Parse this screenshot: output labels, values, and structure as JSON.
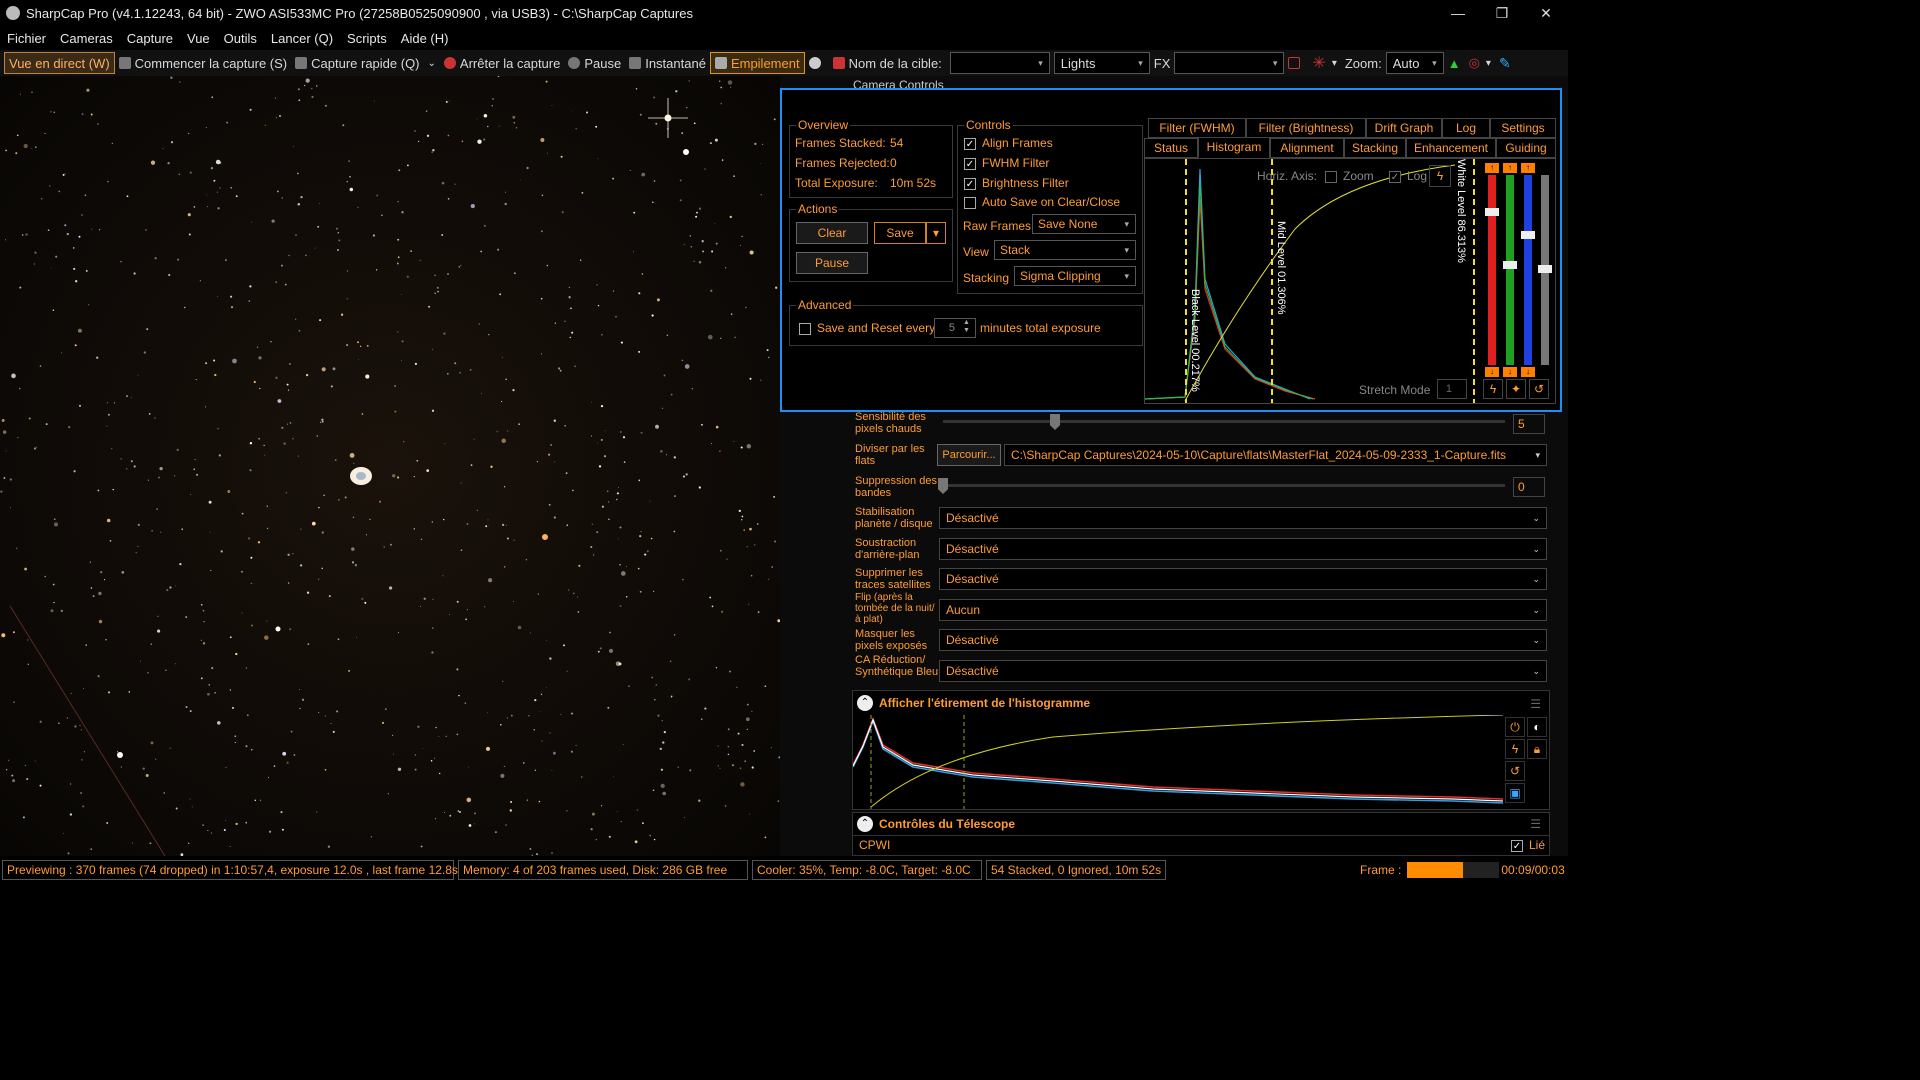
{
  "window": {
    "title": "SharpCap Pro (v4.1.12243, 64 bit) - ZWO ASI533MC Pro (27258B0525090900 , via USB3) - C:\\SharpCap Captures",
    "min": "—",
    "max": "❐",
    "close": "✕"
  },
  "menu": [
    "Fichier",
    "Cameras",
    "Capture",
    "Vue",
    "Outils",
    "Lancer (Q)",
    "Scripts",
    "Aide (H)"
  ],
  "toolbar": {
    "live": "Vue en direct (W)",
    "start_capture": "Commencer la capture (S)",
    "quick_capture": "Capture rapide (Q)",
    "stop_capture": "Arrêter la capture",
    "pause": "Pause",
    "snapshot": "Instantané",
    "stacking": "Empilement",
    "target_label": "Nom de la cible:",
    "target_value": "",
    "frame_type": "Lights",
    "fx_label": "FX",
    "fx_value": "",
    "zoom_label": "Zoom:",
    "zoom_value": "Auto"
  },
  "camera_controls_title": "Camera Controls",
  "stack": {
    "overview_legend": "Overview",
    "frames_stacked_label": "Frames Stacked:",
    "frames_stacked": "54",
    "frames_rejected_label": "Frames Rejected:",
    "frames_rejected": "0",
    "total_exposure_label": "Total Exposure:",
    "total_exposure": "10m 52s",
    "actions_legend": "Actions",
    "clear": "Clear",
    "save": "Save",
    "pause": "Pause",
    "advanced_legend": "Advanced",
    "save_reset_label": "Save and Reset every",
    "save_reset_value": "5",
    "save_reset_suffix": "minutes total exposure",
    "controls_legend": "Controls",
    "align_frames": "Align Frames",
    "fwhm_filter": "FWHM Filter",
    "brightness_filter": "Brightness Filter",
    "auto_save": "Auto Save on Clear/Close",
    "raw_frames_label": "Raw Frames",
    "raw_frames_value": "Save None",
    "view_label": "View",
    "view_value": "Stack",
    "stacking_label": "Stacking",
    "stacking_value": "Sigma Clipping",
    "tabs_top": [
      "Filter (FWHM)",
      "Filter (Brightness)",
      "Drift Graph",
      "Log",
      "Settings"
    ],
    "tabs_bottom": [
      "Status",
      "Histogram",
      "Alignment",
      "Stacking",
      "Enhancement",
      "Guiding"
    ],
    "horiz_axis": "Horiz. Axis:",
    "zoom": "Zoom",
    "log": "Log",
    "black_level": "Black Level  00.217%",
    "mid_level": "Mid Level  01.306%",
    "white_level": "White Level  86.313%",
    "stretch_mode": "Stretch Mode",
    "stretch_value": "1"
  },
  "props": {
    "hot_pixels_label": "Sensibilité des pixels chauds",
    "hot_pixels_value": "5",
    "flats_label": "Diviser par les flats",
    "browse": "Parcourir...",
    "flats_path": "C:\\SharpCap Captures\\2024-05-10\\Capture\\flats\\MasterFlat_2024-05-09-2333_1-Capture.fits",
    "banding_label": "Suppression des bandes",
    "banding_value": "0",
    "stab_label": "Stabilisation planète / disque",
    "stab_value": "Désactivé",
    "bgsub_label": "Soustraction d'arrière-plan",
    "bgsub_value": "Désactivé",
    "sat_label": "Supprimer les traces satellites",
    "sat_value": "Désactivé",
    "flip_label": "Flip (après la tombée de la nuit/à plat)",
    "flip_value": "Aucun",
    "mask_label": "Masquer les pixels exposés",
    "mask_value": "Désactivé",
    "ca_label": "CA Réduction/ Synthétique Bleu",
    "ca_value": "Désactivé"
  },
  "histo_panel": {
    "title": "Afficher l'étirement de l'histogramme"
  },
  "telescope": {
    "title": "Contrôles du Télescope",
    "mount": "CPWI",
    "linked": "Lié"
  },
  "statusbar": {
    "preview": "Previewing : 370 frames (74 dropped) in 1:10:57,4, exposure 12.0s , last frame 12.8s",
    "memory": "Memory: 4 of 203 frames used, Disk: 286 GB free",
    "cooler": "Cooler: 35%, Temp: -8.0C, Target: -8.0C",
    "stacked": "54 Stacked, 0 Ignored, 10m 52s",
    "frame_label": "Frame :",
    "frame_progress": 0.6,
    "frame_time": "00:09/00:03"
  },
  "colors": {
    "accent": "#ff9c33",
    "focus_border": "#1e8ff5",
    "progress": "#ff8c00"
  }
}
